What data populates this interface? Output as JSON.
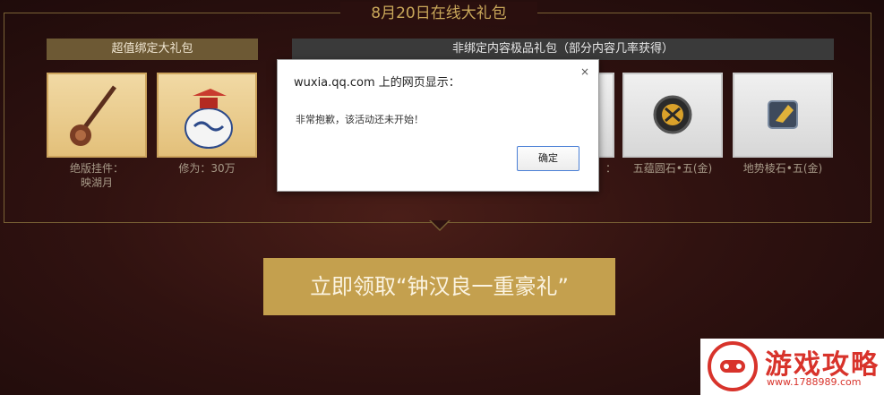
{
  "page": {
    "title": "8月20日在线大礼包"
  },
  "tabs": {
    "bound": "超值绑定大礼包",
    "unbound": "非绑定内容极品礼包（部分内容几率获得）"
  },
  "items": [
    {
      "caption": "绝版挂件：\n映湖月"
    },
    {
      "caption": "修为：30万"
    },
    {
      "caption": "："
    },
    {
      "caption": "五蕴圆石•五(金)"
    },
    {
      "caption": "地势棱石•五(金)"
    }
  ],
  "claim_button": "立即领取“钟汉良一重豪礼”",
  "dialog": {
    "title": "wuxia.qq.com 上的网页显示：",
    "message": "非常抱歉，该活动还未开始！",
    "ok": "确定",
    "close": "×"
  },
  "watermark": {
    "text": "游戏攻略",
    "url": "www.1788989.com"
  },
  "colors": {
    "gold": "#c4a04e",
    "frame": "#7a6235",
    "bg": "#301210"
  }
}
